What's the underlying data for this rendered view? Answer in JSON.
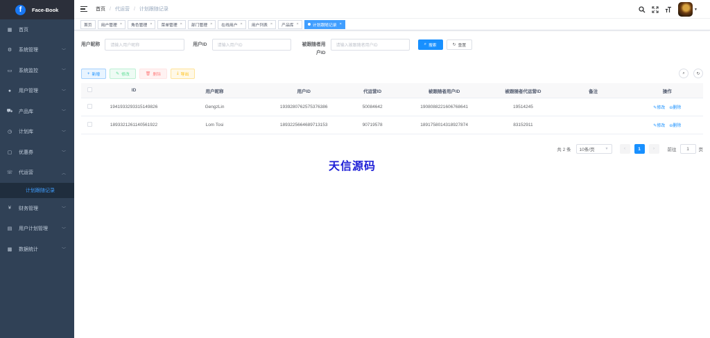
{
  "app": {
    "logo_letter": "f",
    "name": "Face-Book"
  },
  "sidebar": {
    "items": [
      {
        "label": "首页",
        "icon": "dashboard-icon",
        "glyph": "▦",
        "arrow": false
      },
      {
        "label": "系统管理",
        "icon": "gear-icon",
        "glyph": "⚙",
        "arrow": true
      },
      {
        "label": "系统监控",
        "icon": "monitor-icon",
        "glyph": "▭",
        "arrow": true
      },
      {
        "label": "用户管理",
        "icon": "user-icon",
        "glyph": "●",
        "arrow": true
      },
      {
        "label": "产品库",
        "icon": "cart-icon",
        "glyph": "⛟",
        "arrow": true
      },
      {
        "label": "计划库",
        "icon": "clock-icon",
        "glyph": "◷",
        "arrow": true
      },
      {
        "label": "优惠券",
        "icon": "coupon-icon",
        "glyph": "▢",
        "arrow": true
      },
      {
        "label": "代运营",
        "icon": "phone-icon",
        "glyph": "☏",
        "arrow": true,
        "expanded": true
      },
      {
        "label": "财务管理",
        "icon": "yen-icon",
        "glyph": "¥",
        "arrow": true
      },
      {
        "label": "用户计划管理",
        "icon": "table-icon",
        "glyph": "▤",
        "arrow": true
      },
      {
        "label": "数据统计",
        "icon": "chart-icon",
        "glyph": "▩",
        "arrow": true
      }
    ],
    "sub_item": "计划跟随记录"
  },
  "navbar": {
    "breadcrumb": [
      "首页",
      "代运营",
      "计划跟随记录"
    ]
  },
  "tags": [
    {
      "label": "首页",
      "active": false,
      "closable": false
    },
    {
      "label": "用户管理",
      "active": false,
      "closable": true
    },
    {
      "label": "角色管理",
      "active": false,
      "closable": true
    },
    {
      "label": "菜单管理",
      "active": false,
      "closable": true
    },
    {
      "label": "部门管理",
      "active": false,
      "closable": true
    },
    {
      "label": "在线用户",
      "active": false,
      "closable": true
    },
    {
      "label": "用户列表",
      "active": false,
      "closable": true
    },
    {
      "label": "产品库",
      "active": false,
      "closable": true
    },
    {
      "label": "计划跟随记录",
      "active": true,
      "closable": true
    }
  ],
  "search": {
    "nickname_label": "用户昵称",
    "nickname_placeholder": "请输入用户昵称",
    "userid_label": "用户ID",
    "userid_placeholder": "请输入用户ID",
    "followed_label": "被跟随者用户ID",
    "followed_placeholder": "请输入被跟随者用户ID",
    "search_btn": "搜索",
    "reset_btn": "重置"
  },
  "actions": {
    "add": "新增",
    "edit": "修改",
    "delete": "删除",
    "export": "导出"
  },
  "table": {
    "columns": [
      "ID",
      "用户昵称",
      "用户ID",
      "代运营ID",
      "被跟随者用户ID",
      "被跟随者代运营ID",
      "备注",
      "操作"
    ],
    "rows": [
      [
        "1941933293315149826",
        "GengzLin",
        "1939280762575376386",
        "50084642",
        "1908088221606768641",
        "19514245",
        ""
      ],
      [
        "1893321261140561922",
        "Lom Tosi",
        "1893225664689713153",
        "90719578",
        "1891758014318927874",
        "83152911",
        ""
      ]
    ],
    "op_edit": "修改",
    "op_delete": "删除"
  },
  "pagination": {
    "total": "共 2 条",
    "page_size": "10条/页",
    "current_page": "1",
    "goto_label": "前往",
    "goto_value": "1",
    "page_suffix": "页"
  },
  "watermark": "天信源码",
  "colors": {
    "sidebar_bg": "#304156",
    "primary": "#1890ff"
  }
}
